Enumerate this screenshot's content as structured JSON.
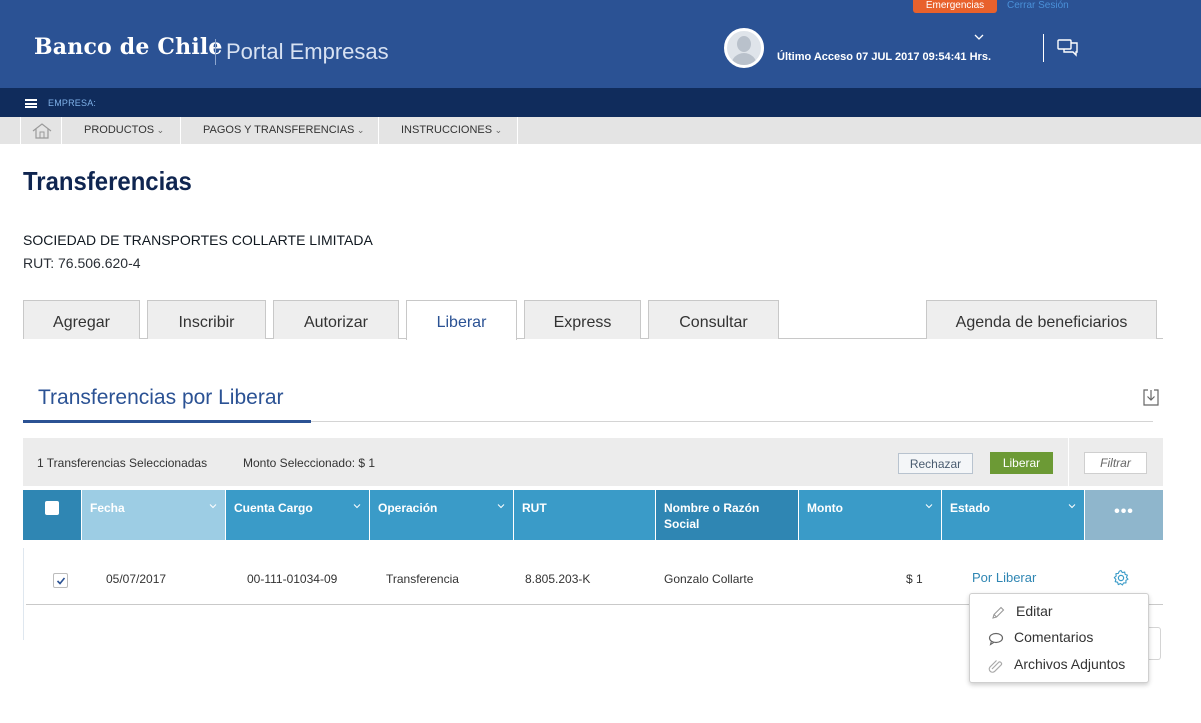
{
  "header": {
    "emergency_label": "Emergencias",
    "logout_label": "Cerrar Sesión",
    "brand": "Banco de Chile",
    "portal_name": "Portal Empresas",
    "last_access": "Último Acceso 07 JUL 2017 09:54:41 Hrs."
  },
  "company_bar": {
    "label": "EMPRESA:"
  },
  "nav": {
    "items": [
      {
        "label": "PRODUCTOS"
      },
      {
        "label": "PAGOS Y TRANSFERENCIAS"
      },
      {
        "label": "INSTRUCCIONES"
      }
    ]
  },
  "page": {
    "title": "Transferencias",
    "company_name": "SOCIEDAD DE TRANSPORTES COLLARTE LIMITADA",
    "company_rut": "RUT: 76.506.620-4"
  },
  "tabs": [
    {
      "label": "Agregar",
      "active": false
    },
    {
      "label": "Inscribir",
      "active": false
    },
    {
      "label": "Autorizar",
      "active": false
    },
    {
      "label": "Liberar",
      "active": true
    },
    {
      "label": "Express",
      "active": false
    },
    {
      "label": "Consultar",
      "active": false
    },
    {
      "label": "Agenda de beneficiarios",
      "active": false
    }
  ],
  "section": {
    "title": "Transferencias por Liberar"
  },
  "toolbar": {
    "selected_count": "1 Transferencias Seleccionadas",
    "selected_amount": "Monto Seleccionado: $  1",
    "reject_label": "Rechazar",
    "release_label": "Liberar",
    "filter_label": "Filtrar"
  },
  "table": {
    "columns": [
      {
        "label": "Fecha"
      },
      {
        "label": "Cuenta Cargo"
      },
      {
        "label": "Operación"
      },
      {
        "label": "RUT"
      },
      {
        "label": "Nombre o Razón Social"
      },
      {
        "label": "Monto"
      },
      {
        "label": "Estado"
      }
    ],
    "more_label": "•••",
    "rows": [
      {
        "checked": true,
        "fecha": "05/07/2017",
        "cuenta": "00-111-01034-09",
        "operacion": "Transferencia",
        "rut": "8.805.203-K",
        "nombre": "Gonzalo Collarte",
        "monto": "$ 1",
        "estado": "Por Liberar"
      }
    ]
  },
  "context_menu": {
    "items": [
      {
        "label": "Editar",
        "icon": "pencil-icon"
      },
      {
        "label": "Comentarios",
        "icon": "speech-bubble-icon"
      },
      {
        "label": "Archivos Adjuntos",
        "icon": "paperclip-icon"
      }
    ]
  },
  "colors": {
    "header_blue": "#2b5294",
    "company_bar": "#102c5c",
    "emergency": "#e8612c",
    "table_header": "#3a9bc8",
    "release_green": "#6c9a35"
  }
}
